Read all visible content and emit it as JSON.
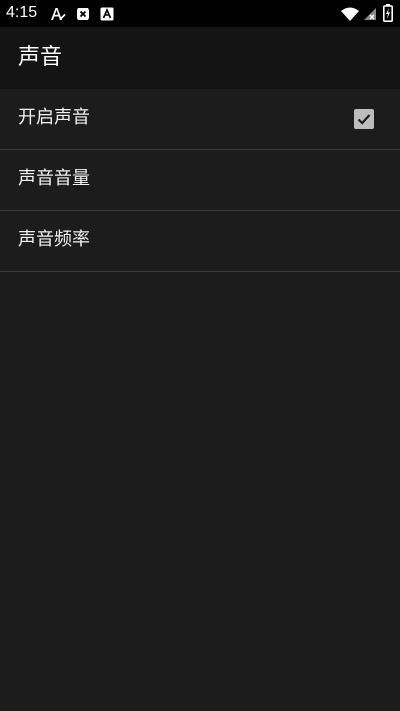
{
  "status_bar": {
    "time": "4:15",
    "icons": [
      "accessibility-a-icon",
      "close-x-icon",
      "a-box-icon",
      "wifi-icon",
      "no-signal-icon",
      "battery-charging-icon"
    ]
  },
  "app_bar": {
    "title": "声音"
  },
  "settings": {
    "items": [
      {
        "label": "开启声音",
        "checked": true
      },
      {
        "label": "声音音量"
      },
      {
        "label": "声音频率"
      }
    ]
  },
  "colors": {
    "background": "#1c1c1c",
    "app_bar": "#141414",
    "status_bar": "#000000",
    "divider": "#3a3a3a",
    "checkbox": "#bdbdbd"
  }
}
